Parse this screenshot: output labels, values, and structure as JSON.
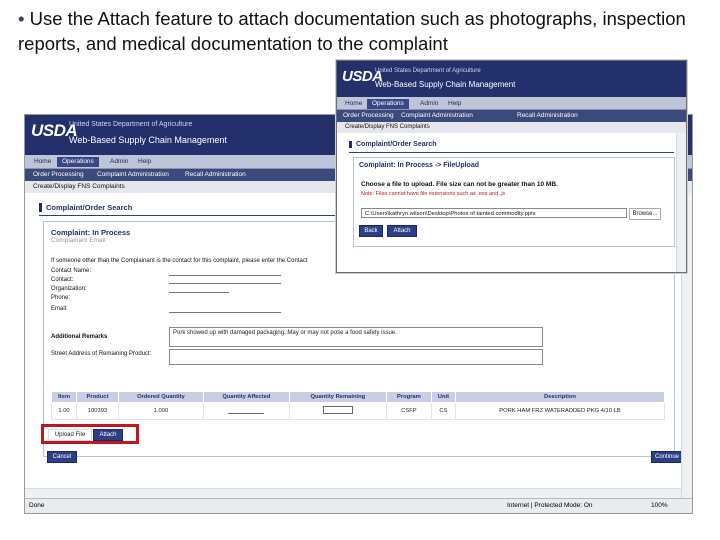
{
  "slide": {
    "bullet": "•",
    "text": "Use the Attach feature to attach documentation such as photographs, inspection reports, and medical documentation to the complaint"
  },
  "main_window": {
    "logo": "USDA",
    "dept": "United States Department of Agriculture",
    "app_title": "Web-Based Supply Chain Management",
    "nav_tabs": [
      "Home",
      "Operations",
      "Admin",
      "Help"
    ],
    "subnav": [
      "Order Processing",
      "Complaint Administration",
      "Recall Administration"
    ],
    "breadcrumb": "Create/Display FNS Complaints",
    "panel_title": "Complaint/Order Search",
    "section_title": "Complaint: In Process",
    "faint_row": "Complainant Email",
    "contact_prompt": "If someone other than the Complainant is the contact for this complaint, please enter the Contact",
    "contact_fields": [
      "Contact Name:",
      "Contact:",
      "Organization:",
      "Phone:",
      "Email:"
    ],
    "additional_remarks_label": "Additional Remarks",
    "additional_remarks_value": "Pork showed up with damaged packaging. May or may not pose a food safety issue.",
    "street_label": "Street Address of Remaining Product:",
    "table": {
      "headers": [
        "Item",
        "Product",
        "Ordered Quantity",
        "Quantity Affected",
        "Quantity Remaining",
        "Program",
        "Unit",
        "Description"
      ],
      "rows": [
        [
          "1.00",
          "100393",
          "1.000",
          "",
          "",
          "CSFP",
          "CS",
          "PORK HAM FRZ WATERADDED PKG 4/10 LB"
        ]
      ]
    },
    "upload_label": "Upload File",
    "attach_button": "Attach",
    "cancel_button": "Cancel",
    "continue_button": "Continue",
    "status_left": "Done",
    "status_zone": "Internet | Protected Mode: On",
    "zoom": "100%"
  },
  "popup_window": {
    "logo": "USDA",
    "dept": "United States Department of Agriculture",
    "app_title": "Web-Based Supply Chain Management",
    "nav_tabs": [
      "Home",
      "Operations",
      "Admin",
      "Help"
    ],
    "subnav": [
      "Order Processing",
      "Complaint Administration",
      "Recall Administration"
    ],
    "breadcrumb": "Create/Display FNS Complaints",
    "panel_title": "Complaint/Order Search",
    "section_title": "Complaint: In Process -> FileUpload",
    "message": "Choose a file to upload. File size can not be greater than 10 MB.",
    "red_note": "Note: Files cannot have file extensions such as .exe and .js",
    "file_path": "C:\\Users\\kathryn.wilson\\Desktop\\Photos of tainted commodity.pptx",
    "browse_button": "Browse...",
    "back_button": "Back",
    "attach_button": "Attach"
  },
  "colors": {
    "header": "#23306b",
    "highlight": "#c0161e"
  }
}
